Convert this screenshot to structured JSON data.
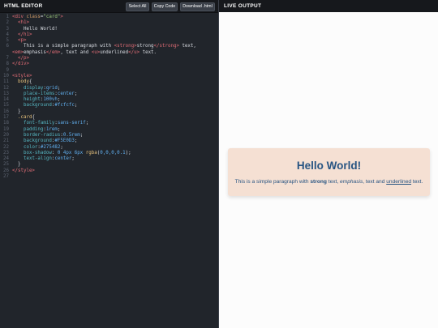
{
  "editor": {
    "title": "HTML EDITOR",
    "buttons": {
      "select_all": "Select All",
      "copy_code": "Copy Code",
      "download": "Download .html"
    }
  },
  "output": {
    "title": "LIVE OUTPUT",
    "heading": "Hello World!",
    "para": {
      "prefix": "This is a simple paragraph with ",
      "strong": "strong",
      "mid1": " text, ",
      "emphasis": "emphasis",
      "mid2": ", text and ",
      "underlined": "underlined",
      "suffix": " text."
    }
  },
  "colors": {
    "editor_bg": "#21252b",
    "header_bg": "#16181c",
    "output_bg": "#fcfcfc",
    "card_bg": "#f5e0d3",
    "card_text": "#275482"
  },
  "code_lines": [
    {
      "n": "1",
      "segs": [
        [
          "t",
          "<div "
        ],
        [
          "a",
          "class"
        ],
        [
          "x",
          "="
        ],
        [
          "s",
          "\"card\""
        ],
        [
          "t",
          ">"
        ]
      ]
    },
    {
      "n": "2",
      "segs": [
        [
          "x",
          "  "
        ],
        [
          "t",
          "<h1>"
        ]
      ]
    },
    {
      "n": "3",
      "segs": [
        [
          "x",
          "    Hello World!"
        ]
      ]
    },
    {
      "n": "4",
      "segs": [
        [
          "x",
          "  "
        ],
        [
          "t",
          "</h1>"
        ]
      ]
    },
    {
      "n": "5",
      "segs": [
        [
          "x",
          "  "
        ],
        [
          "t",
          "<p>"
        ]
      ]
    },
    {
      "n": "6",
      "segs": [
        [
          "x",
          "    This is a simple paragraph with "
        ],
        [
          "t",
          "<strong>"
        ],
        [
          "x",
          "strong"
        ],
        [
          "t",
          "</strong>"
        ],
        [
          "x",
          " text,"
        ]
      ]
    },
    {
      "n": "",
      "segs": [
        [
          "t",
          "<em>"
        ],
        [
          "x",
          "emphasis"
        ],
        [
          "t",
          "</em>"
        ],
        [
          "x",
          ", text and "
        ],
        [
          "t",
          "<u>"
        ],
        [
          "x",
          "underlined"
        ],
        [
          "t",
          "</u>"
        ],
        [
          "x",
          " text."
        ]
      ]
    },
    {
      "n": "7",
      "segs": [
        [
          "x",
          "  "
        ],
        [
          "t",
          "</p>"
        ]
      ]
    },
    {
      "n": "8",
      "segs": [
        [
          "t",
          "</div>"
        ]
      ]
    },
    {
      "n": "9",
      "segs": []
    },
    {
      "n": "10",
      "segs": [
        [
          "t",
          "<style>"
        ]
      ]
    },
    {
      "n": "11",
      "segs": [
        [
          "x",
          "  "
        ],
        [
          "sel",
          "body"
        ],
        [
          "x",
          "{"
        ]
      ]
    },
    {
      "n": "12",
      "segs": [
        [
          "x",
          "    "
        ],
        [
          "p",
          "display"
        ],
        [
          "x",
          ":"
        ],
        [
          "v",
          "grid"
        ],
        [
          "x",
          ";"
        ]
      ]
    },
    {
      "n": "13",
      "segs": [
        [
          "x",
          "    "
        ],
        [
          "p",
          "place-items"
        ],
        [
          "x",
          ":"
        ],
        [
          "v",
          "center"
        ],
        [
          "x",
          ";"
        ]
      ]
    },
    {
      "n": "14",
      "segs": [
        [
          "x",
          "    "
        ],
        [
          "p",
          "height"
        ],
        [
          "x",
          ":"
        ],
        [
          "v",
          "100vh"
        ],
        [
          "x",
          ";"
        ]
      ]
    },
    {
      "n": "15",
      "segs": [
        [
          "x",
          "    "
        ],
        [
          "p",
          "background"
        ],
        [
          "x",
          ":"
        ],
        [
          "v",
          "#fcfcfc"
        ],
        [
          "x",
          ";"
        ]
      ]
    },
    {
      "n": "16",
      "segs": [
        [
          "x",
          "  }"
        ]
      ]
    },
    {
      "n": "17",
      "segs": [
        [
          "x",
          "  "
        ],
        [
          "sel",
          ".card"
        ],
        [
          "x",
          "{"
        ]
      ]
    },
    {
      "n": "18",
      "segs": [
        [
          "x",
          "    "
        ],
        [
          "p",
          "font-family"
        ],
        [
          "x",
          ":"
        ],
        [
          "v",
          "sans-serif"
        ],
        [
          "x",
          ";"
        ]
      ]
    },
    {
      "n": "19",
      "segs": [
        [
          "x",
          "    "
        ],
        [
          "p",
          "padding"
        ],
        [
          "x",
          ":"
        ],
        [
          "v",
          "1rem"
        ],
        [
          "x",
          ";"
        ]
      ]
    },
    {
      "n": "20",
      "segs": [
        [
          "x",
          "    "
        ],
        [
          "p",
          "border-radius"
        ],
        [
          "x",
          ":"
        ],
        [
          "v",
          "0.5rem"
        ],
        [
          "x",
          ";"
        ]
      ]
    },
    {
      "n": "21",
      "segs": [
        [
          "x",
          "    "
        ],
        [
          "p",
          "background"
        ],
        [
          "x",
          ":"
        ],
        [
          "v",
          "#F5E0D3"
        ],
        [
          "x",
          ";"
        ]
      ]
    },
    {
      "n": "22",
      "segs": [
        [
          "x",
          "    "
        ],
        [
          "p",
          "color"
        ],
        [
          "x",
          ":"
        ],
        [
          "v",
          "#275482"
        ],
        [
          "x",
          ";"
        ]
      ]
    },
    {
      "n": "23",
      "segs": [
        [
          "x",
          "    "
        ],
        [
          "p",
          "box-shadow"
        ],
        [
          "x",
          ": "
        ],
        [
          "v",
          "0 4px 6px "
        ],
        [
          "sel",
          "rgba"
        ],
        [
          "x",
          "("
        ],
        [
          "v",
          "0,0,0,0.1"
        ],
        [
          "x",
          ");"
        ]
      ]
    },
    {
      "n": "24",
      "segs": [
        [
          "x",
          "    "
        ],
        [
          "p",
          "text-align"
        ],
        [
          "x",
          ":"
        ],
        [
          "v",
          "center"
        ],
        [
          "x",
          ";"
        ]
      ]
    },
    {
      "n": "25",
      "segs": [
        [
          "x",
          "  }"
        ]
      ]
    },
    {
      "n": "26",
      "segs": [
        [
          "t",
          "</style>"
        ]
      ]
    },
    {
      "n": "27",
      "segs": []
    }
  ]
}
